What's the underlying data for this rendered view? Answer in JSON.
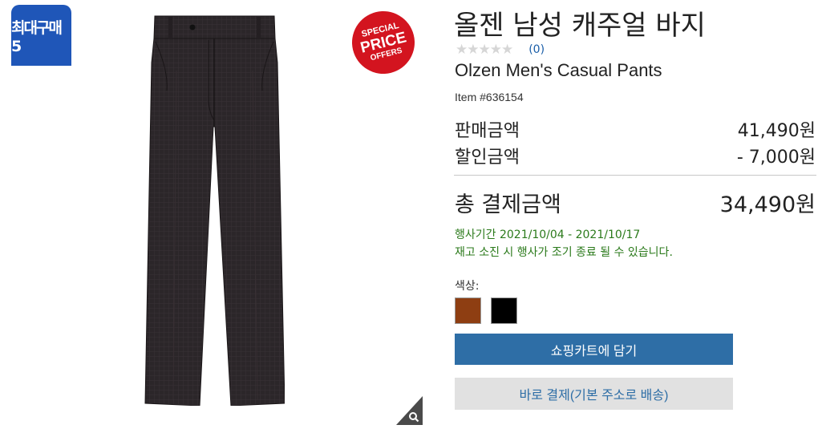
{
  "gallery": {
    "max_purchase_badge": "최대구매 5",
    "special_badge": {
      "line1": "SPECIAL",
      "line2": "PRICE",
      "line3": "OFFERS"
    },
    "zoom_icon": "magnifier-icon"
  },
  "product": {
    "title_ko": "올젠 남성 캐주얼 바지",
    "stars": "★★★★★",
    "review_count": "(0)",
    "title_en": "Olzen Men's Casual Pants",
    "item_number": "Item #636154"
  },
  "pricing": {
    "sale_label": "판매금액",
    "sale_value": "41,490원",
    "discount_label": "할인금액",
    "discount_value": "- 7,000원",
    "total_label": "총 결제금액",
    "total_value": "34,490원"
  },
  "event": {
    "period": "행사기간 2021/10/04 - 2021/10/17",
    "note": "재고 소진 시 행사가 조기 종료 될 수 있습니다."
  },
  "options": {
    "color_label": "색상:",
    "colors": [
      {
        "name": "brown",
        "hex": "#8e3e12"
      },
      {
        "name": "black",
        "hex": "#000000"
      }
    ]
  },
  "actions": {
    "add_to_cart": "쇼핑카트에 담기",
    "buy_now": "바로 결제(기본 주소로 배송)"
  },
  "colors": {
    "accent": "#2e6ea6",
    "badge_blue": "#1f56b8",
    "badge_red": "#d3141f",
    "event_green": "#2b7a1b"
  }
}
